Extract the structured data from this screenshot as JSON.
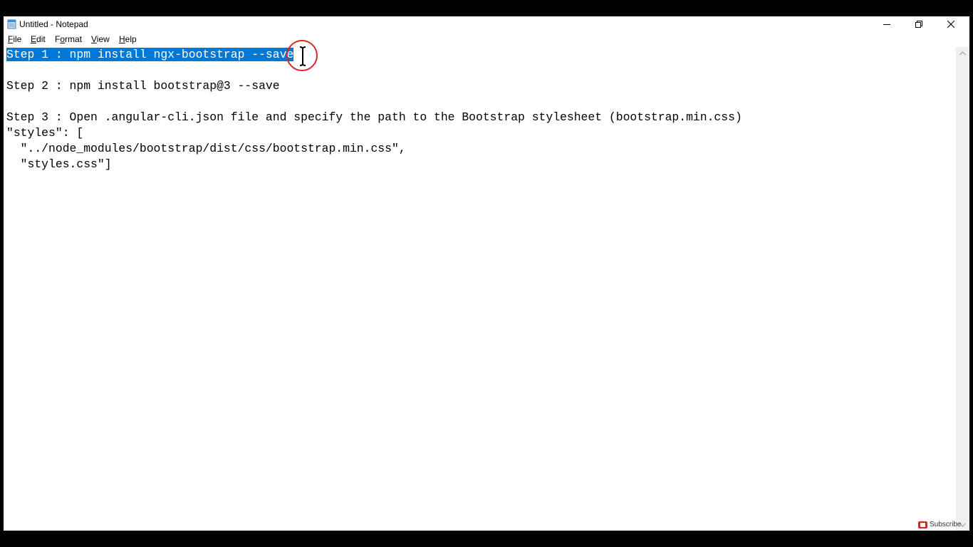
{
  "window": {
    "title": "Untitled - Notepad"
  },
  "menu": {
    "file": {
      "accel": "F",
      "rest": "ile"
    },
    "edit": {
      "accel": "E",
      "rest": "dit"
    },
    "format": {
      "pre": "F",
      "accel": "o",
      "rest": "rmat"
    },
    "view": {
      "accel": "V",
      "rest": "iew"
    },
    "help": {
      "accel": "H",
      "rest": "elp"
    }
  },
  "editor": {
    "selected_text": "Step 1 : npm install ngx-bootstrap --save",
    "lines": [
      "",
      "Step 2 : npm install bootstrap@3 --save",
      "",
      "Step 3 : Open .angular-cli.json file and specify the path to the Bootstrap stylesheet (bootstrap.min.css)",
      "\"styles\": [",
      "  \"../node_modules/bootstrap/dist/css/bootstrap.min.css\",",
      "  \"styles.css\"]"
    ]
  },
  "overlay": {
    "subscribe_label": "Subscribe"
  },
  "icons": {
    "app": "notepad-icon",
    "minimize": "minimize-icon",
    "restore": "restore-icon",
    "close": "close-icon",
    "cursor": "text-cursor-icon"
  },
  "colors": {
    "selection": "#0078d7",
    "highlight_circle": "#d8262a",
    "youtube_red": "#e62117"
  }
}
